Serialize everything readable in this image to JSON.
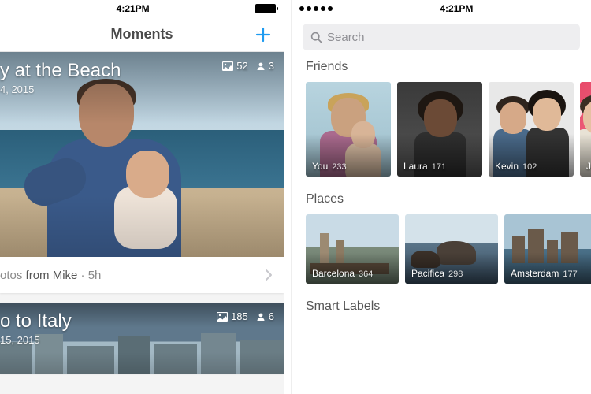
{
  "status": {
    "time": "4:21PM"
  },
  "left": {
    "title": "Moments",
    "plus_icon": "plus-icon",
    "cards": [
      {
        "title": "y at the Beach",
        "date": "4, 2015",
        "photo_count": "52",
        "people_count": "3",
        "meta_prefix": "otos",
        "meta_from": " from ",
        "meta_name": "Mike",
        "meta_sep": " · ",
        "meta_time": "5h"
      },
      {
        "title": "o to Italy",
        "date": "15, 2015",
        "photo_count": "185",
        "people_count": "6"
      }
    ]
  },
  "right": {
    "search_placeholder": "Search",
    "sections": {
      "friends": {
        "title": "Friends",
        "items": [
          {
            "name": "You",
            "count": "233"
          },
          {
            "name": "Laura",
            "count": "171"
          },
          {
            "name": "Kevin",
            "count": "102"
          },
          {
            "name": "Je",
            "count": ""
          }
        ]
      },
      "places": {
        "title": "Places",
        "items": [
          {
            "name": "Barcelona",
            "count": "364"
          },
          {
            "name": "Pacifica",
            "count": "298"
          },
          {
            "name": "Amsterdam",
            "count": "177"
          },
          {
            "name": "",
            "count": ""
          }
        ]
      },
      "smart": {
        "title": "Smart Labels"
      }
    }
  }
}
